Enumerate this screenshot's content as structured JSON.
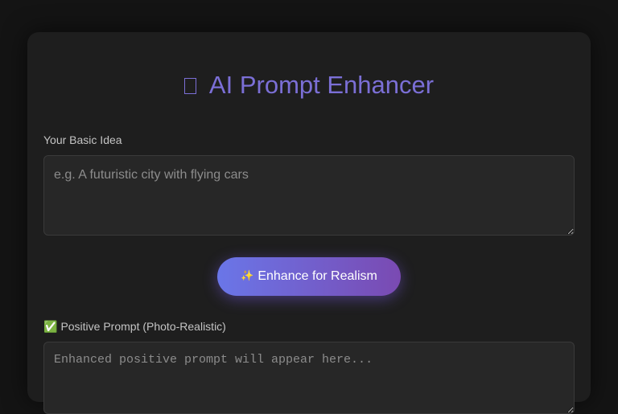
{
  "header": {
    "icon": "broken-glyph-icon",
    "title": "AI Prompt Enhancer"
  },
  "idea": {
    "label": "Your Basic Idea",
    "placeholder": "e.g. A futuristic city with flying cars",
    "value": ""
  },
  "enhance_button": {
    "icon": "sparkle-icon",
    "label": "Enhance for Realism"
  },
  "positive_prompt": {
    "icon": "check-icon",
    "label": "Positive Prompt (Photo-Realistic)",
    "placeholder": "Enhanced positive prompt will appear here...",
    "value": ""
  },
  "colors": {
    "page_bg": "#141414",
    "card_bg": "#1e1e1e",
    "title": "#7b6fd6",
    "button_start": "#6a76e8",
    "button_end": "#7a4ab2"
  }
}
